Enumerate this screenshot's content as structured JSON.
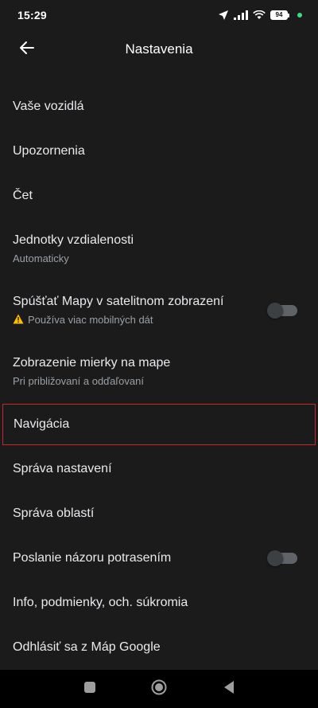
{
  "status_bar": {
    "time": "15:29",
    "battery": "94",
    "icons": [
      "location-arrow-icon",
      "signal-icon",
      "wifi-icon",
      "battery-icon",
      "dot-icon"
    ]
  },
  "header": {
    "title": "Nastavenia",
    "back_icon": "arrow-left-icon"
  },
  "settings": {
    "vehicles": {
      "title": "Vaše vozidlá"
    },
    "notifications": {
      "title": "Upozornenia"
    },
    "chat": {
      "title": "Čet"
    },
    "distance_units": {
      "title": "Jednotky vzdialenosti",
      "subtitle": "Automaticky"
    },
    "satellite": {
      "title": "Spúšťať Mapy v satelitnom zobrazení",
      "subtitle": "Používa viac mobilných dát",
      "enabled": false
    },
    "scale": {
      "title": "Zobrazenie mierky na mape",
      "subtitle": "Pri približovaní a odďaľovaní"
    },
    "navigation": {
      "title": "Navigácia",
      "highlight_color": "#c62828"
    },
    "manage_settings": {
      "title": "Správa nastavení"
    },
    "manage_areas": {
      "title": "Správa oblastí"
    },
    "shake_feedback": {
      "title": "Poslanie názoru potrasením",
      "enabled": false
    },
    "info": {
      "title": "Info, podmienky, och. súkromia"
    },
    "sign_out": {
      "title": "Odhlásiť sa z Máp Google"
    }
  },
  "system_nav": {
    "buttons": [
      "recents-icon",
      "home-icon",
      "back-triangle-icon"
    ]
  },
  "colors": {
    "background": "#1b1b1b",
    "text_primary": "#e8eaed",
    "text_secondary": "#9aa0a6",
    "highlight_border": "#c62828",
    "status_dot": "#3ddc84"
  }
}
